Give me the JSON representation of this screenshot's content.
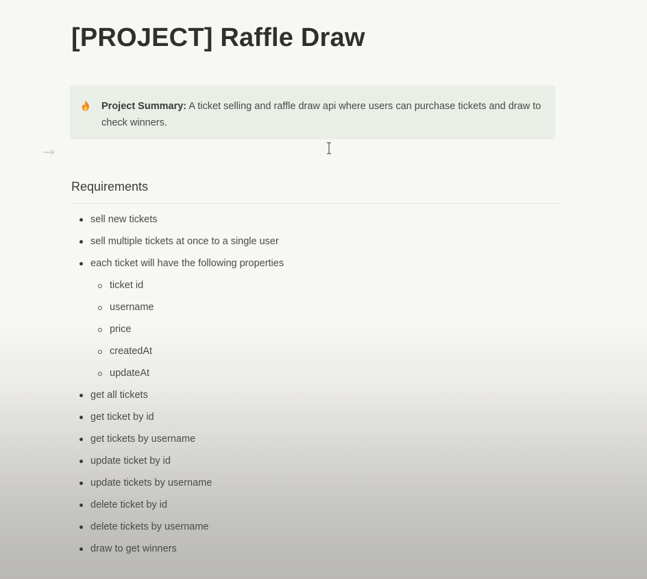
{
  "page": {
    "title": "[PROJECT] Raffle Draw"
  },
  "callout": {
    "icon": "fire-icon",
    "label": "Project Summary:",
    "text": "A ticket selling and raffle draw api where users can purchase tickets and draw to check winners."
  },
  "requirements": {
    "heading": "Requirements",
    "items": [
      {
        "level": 1,
        "text": "sell new tickets"
      },
      {
        "level": 1,
        "text": "sell multiple tickets at once to a single user"
      },
      {
        "level": 1,
        "text": "each ticket will have the following properties"
      },
      {
        "level": 2,
        "text": "ticket id"
      },
      {
        "level": 2,
        "text": "username"
      },
      {
        "level": 2,
        "text": "price"
      },
      {
        "level": 2,
        "text": "createdAt"
      },
      {
        "level": 2,
        "text": "updateAt"
      },
      {
        "level": 1,
        "text": "get all tickets"
      },
      {
        "level": 1,
        "text": "get ticket by id"
      },
      {
        "level": 1,
        "text": "get tickets by username"
      },
      {
        "level": 1,
        "text": "update ticket by id"
      },
      {
        "level": 1,
        "text": "update tickets by username"
      },
      {
        "level": 1,
        "text": "delete ticket by id"
      },
      {
        "level": 1,
        "text": "delete tickets by username"
      },
      {
        "level": 1,
        "text": "draw to get winners"
      }
    ]
  }
}
